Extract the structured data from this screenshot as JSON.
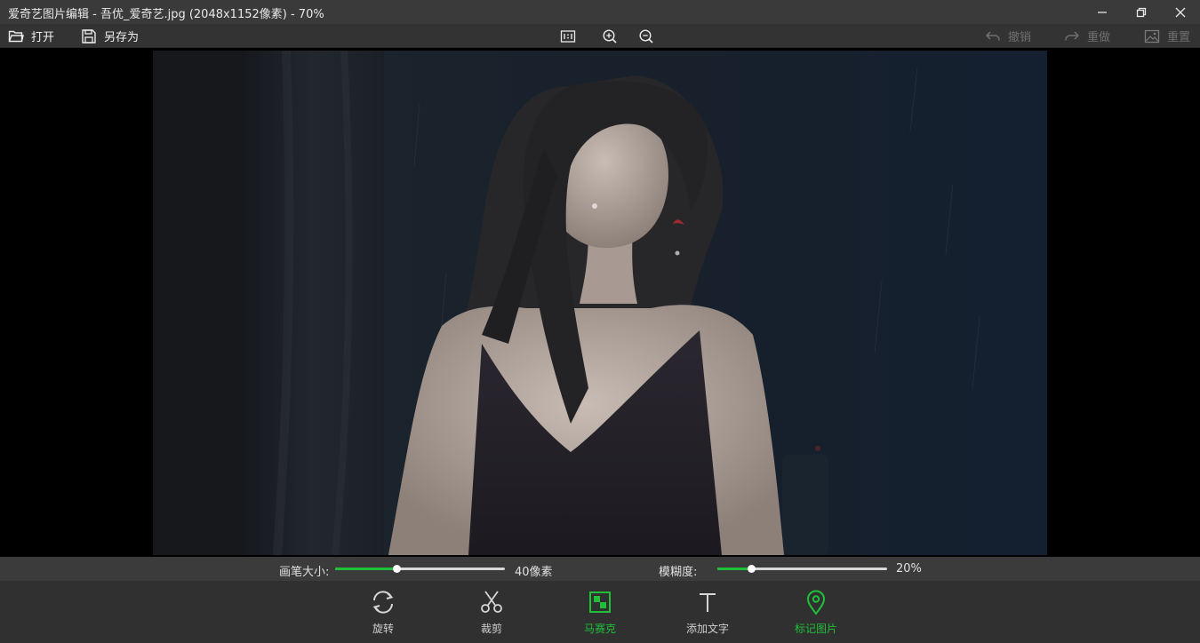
{
  "window": {
    "title": "爱奇艺图片编辑 - 吾优_爱奇艺.jpg (2048x1152像素) - 70%"
  },
  "toolbar": {
    "open_label": "打开",
    "save_as_label": "另存为",
    "undo_label": "撤销",
    "redo_label": "重做",
    "reset_label": "重置"
  },
  "sliders": {
    "brush_size": {
      "label": "画笔大小:",
      "value_text": "40像素",
      "fraction": 0.36
    },
    "blur": {
      "label": "模糊度:",
      "value_text": "20%",
      "fraction": 0.2
    }
  },
  "tools": [
    {
      "label": "旋转",
      "icon": "rotate-icon",
      "active": false
    },
    {
      "label": "裁剪",
      "icon": "scissors-icon",
      "active": false
    },
    {
      "label": "马赛克",
      "icon": "mosaic-icon",
      "active": true
    },
    {
      "label": "添加文字",
      "icon": "text-icon",
      "active": false
    },
    {
      "label": "标记图片",
      "icon": "map-pin-icon",
      "active": false
    }
  ],
  "colors": {
    "accent": "#1fbf3a",
    "titlebar": "#3a3a3a",
    "toolbar": "#333333",
    "bottombar": "#303030",
    "disabled_text": "#6f6f6f"
  }
}
